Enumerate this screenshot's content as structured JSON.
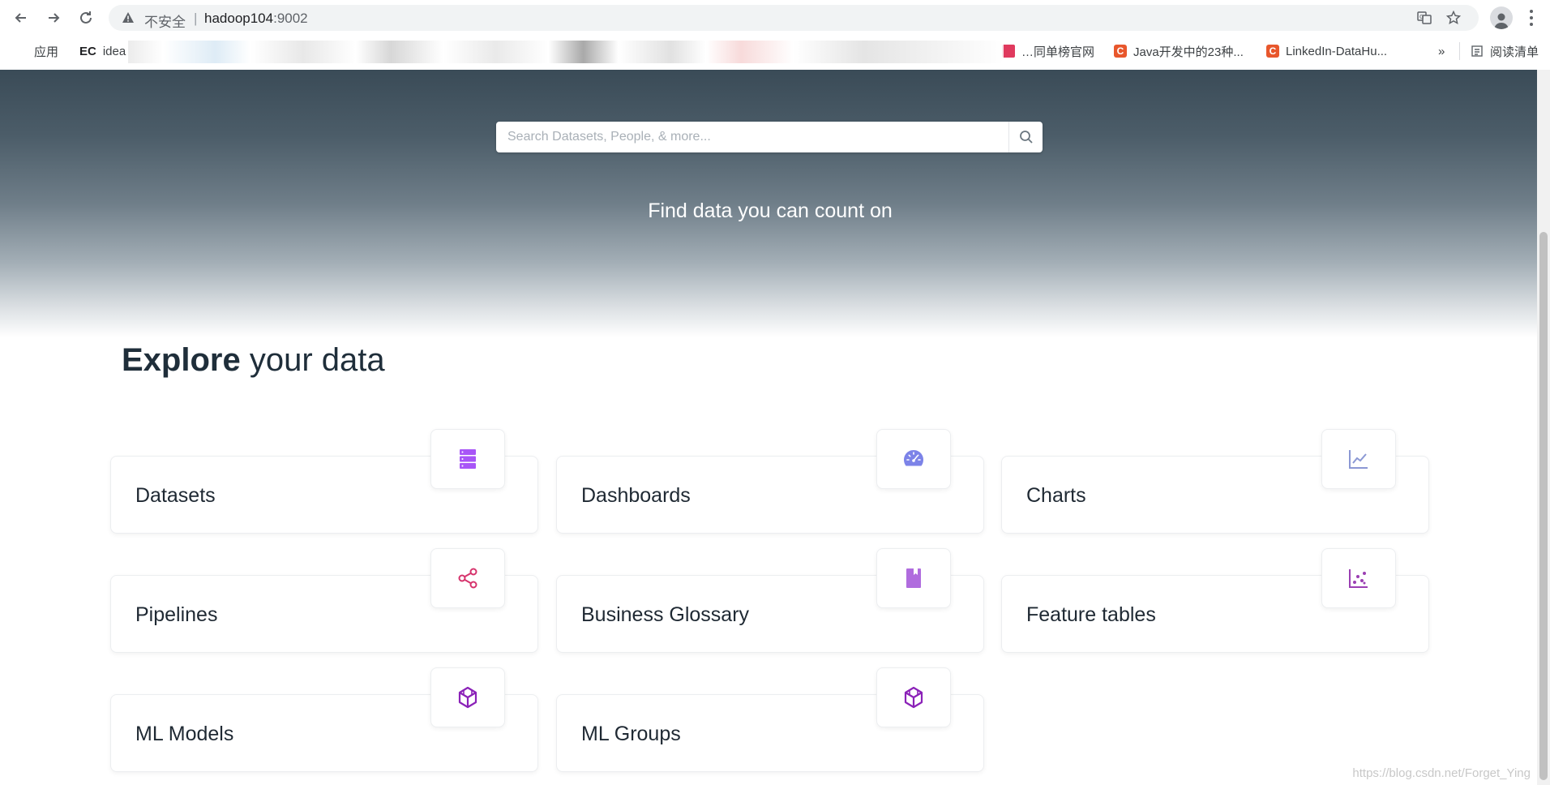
{
  "browser": {
    "insecure_label": "不安全",
    "separator": "|",
    "url_host": "hadoop104",
    "url_port": ":9002",
    "icons": [
      "back-arrow-icon",
      "forward-arrow-icon",
      "reload-icon",
      "warning-icon",
      "translate-icon",
      "star-icon",
      "profile-icon",
      "menu-icon"
    ]
  },
  "bookmarks": {
    "apps_label": "应用",
    "ec_label": "EC",
    "ec_text": "idea",
    "items": [
      {
        "label": "…同单榜官网"
      },
      {
        "label": "Java开发中的23种..."
      },
      {
        "label": "LinkedIn-DataHu..."
      }
    ],
    "more": "»",
    "reading_list": "阅读清单",
    "colors": {
      "csdn": "#e8572c"
    }
  },
  "hero": {
    "search_placeholder": "Search Datasets, People, & more...",
    "tagline": "Find data you can count on"
  },
  "explore": {
    "title_bold": "Explore",
    "title_rest": " your data"
  },
  "cards": [
    {
      "label": "Datasets",
      "icon": "database-icon",
      "color": "#a855f7"
    },
    {
      "label": "Dashboards",
      "icon": "dashboard-gauge-icon",
      "color": "#7c83e8"
    },
    {
      "label": "Charts",
      "icon": "line-chart-icon",
      "color": "#8b98d4"
    },
    {
      "label": "Pipelines",
      "icon": "share-nodes-icon",
      "color": "#d6336c"
    },
    {
      "label": "Business Glossary",
      "icon": "book-icon",
      "color": "#b06cde"
    },
    {
      "label": "Feature tables",
      "icon": "dot-chart-icon",
      "color": "#9b3fb3"
    },
    {
      "label": "ML Models",
      "icon": "code-sandbox-icon",
      "color": "#8b22b8"
    },
    {
      "label": "ML Groups",
      "icon": "code-sandbox-icon",
      "color": "#8b22b8"
    }
  ],
  "watermark": "https://blog.csdn.net/Forget_Ying"
}
